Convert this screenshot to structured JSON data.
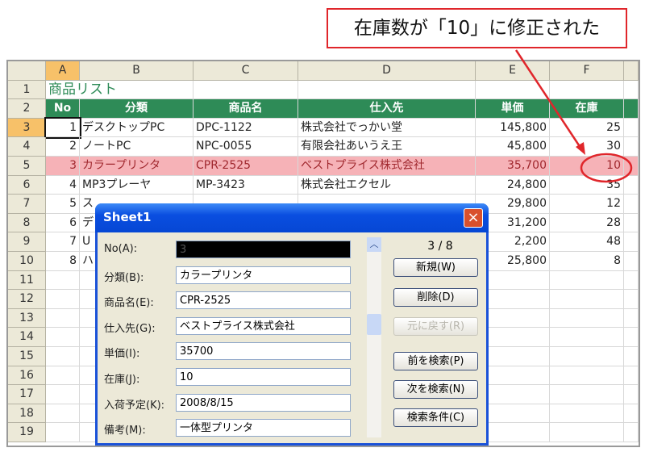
{
  "callout": "在庫数が「10」に修正された",
  "columns": [
    "A",
    "B",
    "C",
    "D",
    "E",
    "F"
  ],
  "row_numbers": [
    "1",
    "2",
    "3",
    "4",
    "5",
    "6",
    "7",
    "8",
    "9",
    "10",
    "11",
    "12",
    "13",
    "14",
    "15",
    "16",
    "17",
    "18",
    "19"
  ],
  "title": "商品リスト",
  "headers": [
    "No",
    "分類",
    "商品名",
    "仕入先",
    "単価",
    "在庫"
  ],
  "rows": [
    [
      "1",
      "デスクトップPC",
      "DPC-1122",
      "株式会社でっかい堂",
      "145,800",
      "25"
    ],
    [
      "2",
      "ノートPC",
      "NPC-0055",
      "有限会社あいうえ王",
      "45,800",
      "30"
    ],
    [
      "3",
      "カラープリンタ",
      "CPR-2525",
      "ベストプライス株式会社",
      "35,700",
      "10"
    ],
    [
      "4",
      "MP3プレーヤ",
      "MP-3423",
      "株式会社エクセル",
      "24,800",
      "35"
    ],
    [
      "5",
      "ス",
      "",
      "",
      "29,800",
      "12"
    ],
    [
      "6",
      "デ",
      "",
      "",
      "31,200",
      "28"
    ],
    [
      "7",
      "U",
      "",
      "",
      "2,200",
      "48"
    ],
    [
      "8",
      "ハ",
      "",
      "",
      "25,800",
      "8"
    ]
  ],
  "dialog": {
    "title": "Sheet1",
    "counter": "3 / 8",
    "fields": [
      {
        "label": "No(A):",
        "value": "3"
      },
      {
        "label": "分類(B):",
        "value": "カラープリンタ"
      },
      {
        "label": "商品名(E):",
        "value": "CPR-2525"
      },
      {
        "label": "仕入先(G):",
        "value": "ベストプライス株式会社"
      },
      {
        "label": "単価(I):",
        "value": "35700"
      },
      {
        "label": "在庫(J):",
        "value": "10"
      },
      {
        "label": "入荷予定(K):",
        "value": "2008/8/15"
      },
      {
        "label": "備考(M):",
        "value": "一体型プリンタ"
      }
    ],
    "buttons": [
      "新規(W)",
      "削除(D)",
      "元に戻す(R)",
      "前を検索(P)",
      "次を検索(N)",
      "検索条件(C)"
    ],
    "close_icon": "×"
  },
  "colors": {
    "header_green": "#2e8b57",
    "highlight": "#f6b2b7",
    "annotation": "#e0262b"
  }
}
